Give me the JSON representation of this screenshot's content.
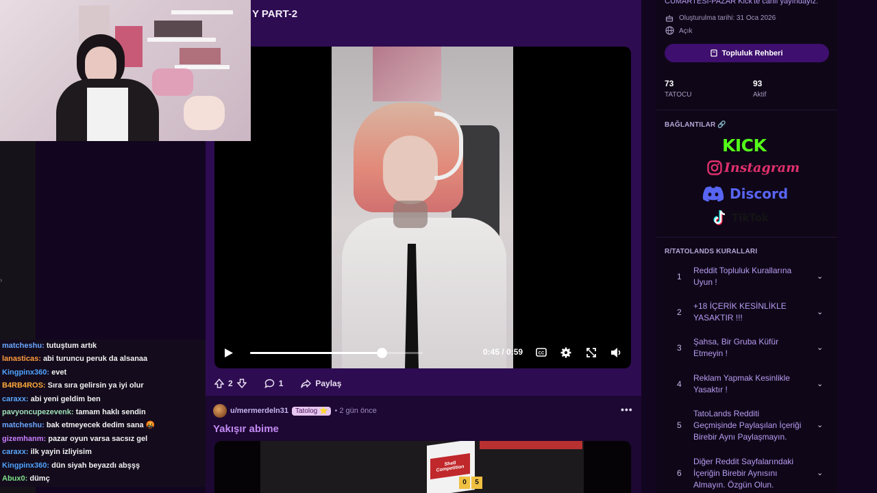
{
  "post1": {
    "title_fragment": "Y PART-2",
    "video": {
      "current_time": "0:45",
      "duration": "0:59",
      "time_display": "0:45 / 0:59",
      "progress": 0.76
    },
    "actions": {
      "vote_count": "2",
      "comment_count": "1",
      "share_label": "Paylaş"
    }
  },
  "post2": {
    "username": "u/mermerdeln31",
    "flair": "Tatolog ⭐",
    "time": "• 2 gün önce",
    "more": "•••",
    "title": "Yakışır abime",
    "video_text": "Shell Competition",
    "video_digits": [
      "0",
      "5"
    ]
  },
  "chat": [
    {
      "user": "matcheshu:",
      "msg": "tutuştum artık",
      "color": "#6aa7ff"
    },
    {
      "user": "lanasticas:",
      "msg": "abi turuncu peruk da alsanaa",
      "color": "#ff9b3d"
    },
    {
      "user": "Kingpinx360:",
      "msg": "evet",
      "color": "#4fa3ff"
    },
    {
      "user": "B4RB4ROS:",
      "msg": "Sıra sıra gelirsin ya iyi olur",
      "color": "#ffa93a"
    },
    {
      "user": "caraxx:",
      "msg": "abi yeni geldim ben",
      "color": "#5aa8ff"
    },
    {
      "user": "pavyoncupezevenk:",
      "msg": "tamam haklı sendin",
      "color": "#9fe0b8"
    },
    {
      "user": "matcheshu:",
      "msg": "bak etmeyecek dedim sana 🤬",
      "color": "#6aa7ff"
    },
    {
      "user": "gizemhanm:",
      "msg": "pazar oyun varsa sacsız gel",
      "color": "#c77dff"
    },
    {
      "user": "caraxx:",
      "msg": "ilk yayin izliyisim",
      "color": "#5aa8ff"
    },
    {
      "user": "Kingpinx360:",
      "msg": "dün siyah beyazdı abşşş",
      "color": "#4fa3ff"
    },
    {
      "user": "Abux0:",
      "msg": "dümç",
      "color": "#7ee08a"
    }
  ],
  "sidebar": {
    "description": "CUMARTESİ-PAZAR Kick'te canlı yayındayız.",
    "created": "Oluşturulma tarihi: 31 Oca 2026",
    "visibility": "Açık",
    "guide_button": "Topluluk Rehberi",
    "stats": [
      {
        "value": "73",
        "label": "TATOCU"
      },
      {
        "value": "93",
        "label": "Aktif"
      }
    ],
    "links_heading": "BAĞLANTILAR 🔗",
    "links": [
      "KICK",
      "Instagram",
      "Discord",
      "TikTok"
    ],
    "rules_heading": "R/TATOLANDS KURALLARI",
    "rules": [
      {
        "num": "1",
        "text": "Reddit Topluluk Kurallarına Uyun !"
      },
      {
        "num": "2",
        "text": "+18 İÇERİK KESİNLİKLE YASAKTIR !!!"
      },
      {
        "num": "3",
        "text": "Şahsa, Bir Gruba Küfür Etmeyin !"
      },
      {
        "num": "4",
        "text": "Reklam Yapmak Kesinlikle Yasaktır !"
      },
      {
        "num": "5",
        "text": "TatoLands Redditi Geçmişinde Paylaşılan İçeriği Birebir Aynı Paylaşmayın."
      },
      {
        "num": "6",
        "text": "Diğer Reddit Sayfalarındaki İçeriğin Birebir Aynısını Almayın. Özgün Olun."
      }
    ]
  },
  "colors": {
    "page_bg": "#120520",
    "post_bg": "#2e0c52",
    "sidebar_bg": "#0f0718",
    "accent_purple": "#3e0f6e",
    "kick_green": "#53fc18",
    "discord_blue": "#5865f2",
    "instagram_pink": "#e1306c"
  },
  "icons": {
    "play": "play-icon",
    "captions": "cc-icon",
    "settings": "gear-icon",
    "fullscreen": "expand-icon",
    "volume": "volume-icon",
    "upvote": "arrow-up-icon",
    "downvote": "arrow-down-icon",
    "comment": "comment-icon",
    "share": "share-icon",
    "cake": "cake-icon",
    "globe": "globe-icon",
    "book": "book-icon",
    "chevron": "chevron-down-icon"
  }
}
